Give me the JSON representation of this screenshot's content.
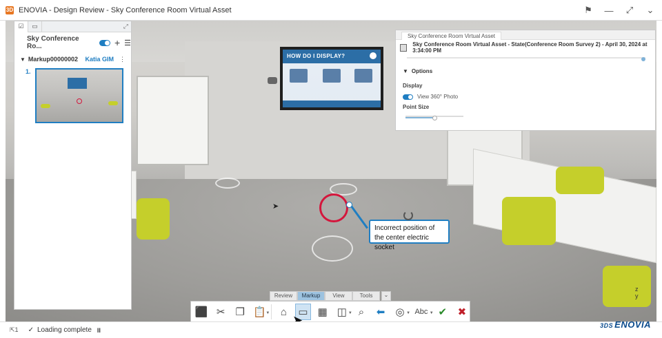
{
  "window": {
    "logo": "3D",
    "title": "ENOVIA - Design Review - Sky Conference Room Virtual Asset",
    "controls": [
      "user-share-icon",
      "minimize-icon",
      "maximize-icon",
      "chevron-down-icon"
    ]
  },
  "left_panel": {
    "tabs": [
      "tree-icon",
      "panel-icon"
    ],
    "title": "Sky Conference Ro...",
    "toggle_on": true,
    "markup": {
      "name": "Markup00000002",
      "user": "Katia GIM"
    },
    "items": [
      {
        "number": "1."
      }
    ]
  },
  "info_panel": {
    "tab_title": "Sky Conference Room Virtual Asset",
    "state_text": "Sky Conference Room Virtual Asset - State(Conference Room Survey 2) - April 30, 2024 at 3:34:00 PM",
    "options_label": "Options",
    "display_label": "Display",
    "view_360_label": "View 360° Photo",
    "view_360_on": true,
    "point_size_label": "Point Size",
    "point_size_fraction": 0.5
  },
  "scene": {
    "tv_heading": "HOW DO I DISPLAY?",
    "callout_text": "Incorrect position of the center electric socket",
    "compass_label": "z\ny"
  },
  "toolbar": {
    "tabs": [
      "Review",
      "Markup",
      "View",
      "Tools"
    ],
    "active_tab": "Markup",
    "tools": [
      {
        "name": "capture-3d-icon",
        "glyph": "⬛"
      },
      {
        "name": "cut-icon",
        "glyph": "✂"
      },
      {
        "name": "copy-icon",
        "glyph": "❐"
      },
      {
        "name": "paste-icon",
        "glyph": "📋"
      },
      {
        "name": "home-icon",
        "glyph": "⌂"
      },
      {
        "name": "markup-rect-icon",
        "glyph": "▭"
      },
      {
        "name": "grid-markup-icon",
        "glyph": "▦"
      },
      {
        "name": "section-icon",
        "glyph": "◫"
      },
      {
        "name": "zoom-section-icon",
        "glyph": "⌕"
      },
      {
        "name": "back-arrow-icon",
        "glyph": "⬅"
      },
      {
        "name": "circle-target-icon",
        "glyph": "◎"
      },
      {
        "name": "text-abc-icon",
        "glyph": "Abc"
      },
      {
        "name": "save-markup-icon",
        "glyph": "✔"
      },
      {
        "name": "delete-markup-icon",
        "glyph": "✖"
      }
    ]
  },
  "status_bar": {
    "selection_count": "1",
    "status_text": "Loading complete",
    "pause_glyph": "II"
  },
  "brand": {
    "ds": "3DS",
    "name": "ENOVIA"
  },
  "colors": {
    "accent": "#1f7ec2",
    "markup_red": "#d4163c",
    "chair_yellow": "#c5cf2b",
    "brand_blue": "#0b4b8d"
  }
}
